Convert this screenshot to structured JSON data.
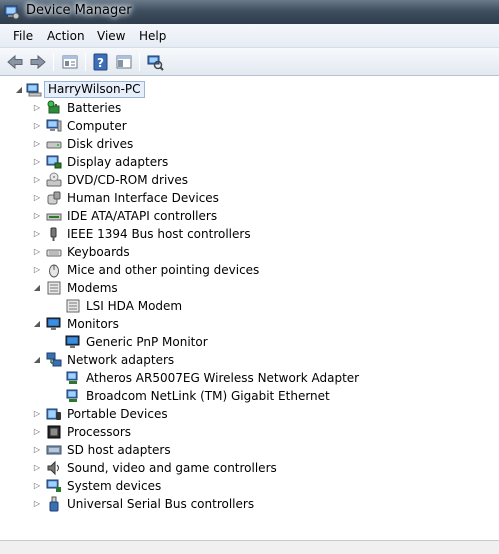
{
  "window": {
    "title": "Device Manager"
  },
  "menu": {
    "items": [
      "File",
      "Action",
      "View",
      "Help"
    ]
  },
  "toolbar": {
    "buttons": [
      "back-icon",
      "forward-icon",
      "properties-icon",
      "help-icon",
      "console-tree-icon",
      "scan-hardware-icon"
    ]
  },
  "tree": {
    "root": "HarryWilson-PC",
    "items": [
      {
        "label": "Batteries",
        "icon": "battery-icon",
        "expanded": false,
        "children": []
      },
      {
        "label": "Computer",
        "icon": "computer-icon",
        "expanded": false,
        "children": []
      },
      {
        "label": "Disk drives",
        "icon": "disk-drive-icon",
        "expanded": false,
        "children": []
      },
      {
        "label": "Display adapters",
        "icon": "display-adapter-icon",
        "expanded": false,
        "children": []
      },
      {
        "label": "DVD/CD-ROM drives",
        "icon": "dvd-drive-icon",
        "expanded": false,
        "children": []
      },
      {
        "label": "Human Interface Devices",
        "icon": "hid-icon",
        "expanded": false,
        "children": []
      },
      {
        "label": "IDE ATA/ATAPI controllers",
        "icon": "ide-controller-icon",
        "expanded": false,
        "children": []
      },
      {
        "label": "IEEE 1394 Bus host controllers",
        "icon": "ieee1394-icon",
        "expanded": false,
        "children": []
      },
      {
        "label": "Keyboards",
        "icon": "keyboard-icon",
        "expanded": false,
        "children": []
      },
      {
        "label": "Mice and other pointing devices",
        "icon": "mouse-icon",
        "expanded": false,
        "children": []
      },
      {
        "label": "Modems",
        "icon": "modem-icon",
        "expanded": true,
        "children": [
          "LSI HDA Modem"
        ]
      },
      {
        "label": "Monitors",
        "icon": "monitor-icon",
        "expanded": true,
        "children": [
          "Generic PnP Monitor"
        ]
      },
      {
        "label": "Network adapters",
        "icon": "network-adapter-icon",
        "expanded": true,
        "children": [
          "Atheros AR5007EG Wireless Network Adapter",
          "Broadcom NetLink (TM) Gigabit Ethernet"
        ]
      },
      {
        "label": "Portable Devices",
        "icon": "portable-device-icon",
        "expanded": false,
        "children": []
      },
      {
        "label": "Processors",
        "icon": "processor-icon",
        "expanded": false,
        "children": []
      },
      {
        "label": "SD host adapters",
        "icon": "sd-adapter-icon",
        "expanded": false,
        "children": []
      },
      {
        "label": "Sound, video and game controllers",
        "icon": "sound-icon",
        "expanded": false,
        "children": []
      },
      {
        "label": "System devices",
        "icon": "system-device-icon",
        "expanded": false,
        "children": []
      },
      {
        "label": "Universal Serial Bus controllers",
        "icon": "usb-icon",
        "expanded": false,
        "children": []
      }
    ]
  }
}
